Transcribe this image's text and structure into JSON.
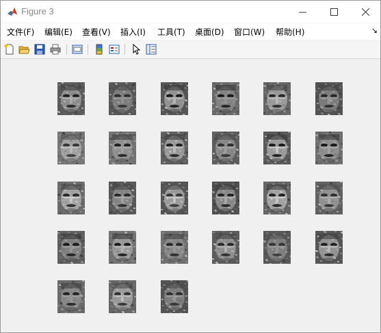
{
  "window": {
    "title": "Figure 3",
    "minimize_glyph": "—",
    "maximize_glyph": "☐",
    "close_glyph": "✕"
  },
  "menu": {
    "items": [
      "文件(F)",
      "编辑(E)",
      "查看(V)",
      "插入(I)",
      "工具(T)",
      "桌面(D)",
      "窗口(W)",
      "帮助(H)"
    ],
    "overflow_glyph": "↘"
  },
  "toolbar": {
    "tools": [
      "new-figure-icon",
      "open-file-icon",
      "save-icon",
      "print-icon",
      "print-preview-icon",
      "colorbar-icon",
      "legend-icon",
      "pointer-icon",
      "property-editor-icon"
    ]
  },
  "figure": {
    "rows": 5,
    "cols": 6,
    "image_count": 27,
    "image_type": "grayscale eigenface"
  }
}
